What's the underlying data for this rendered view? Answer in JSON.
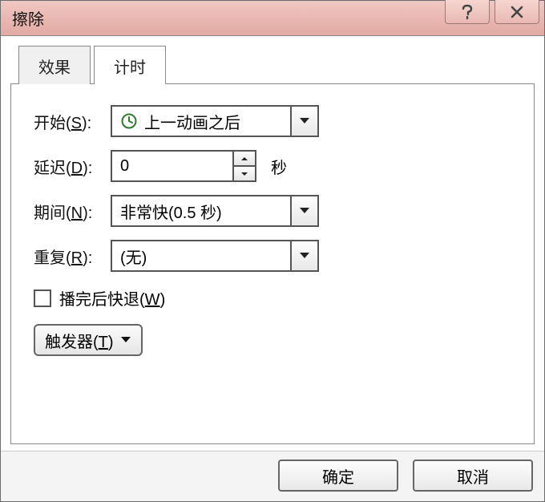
{
  "title": "擦除",
  "tabs": {
    "effect": "效果",
    "timing": "计时"
  },
  "labels": {
    "start_prefix": "开始(",
    "start_key": "S",
    "start_suffix": "):",
    "delay_prefix": "延迟(",
    "delay_key": "D",
    "delay_suffix": "):",
    "duration_prefix": "期间(",
    "duration_key": "N",
    "duration_suffix": "):",
    "repeat_prefix": "重复(",
    "repeat_key": "R",
    "repeat_suffix": "):",
    "delay_unit": "秒",
    "rewind_prefix": "播完后快退(",
    "rewind_key": "W",
    "rewind_suffix": ")",
    "trigger_prefix": "触发器(",
    "trigger_key": "T",
    "trigger_suffix": ")"
  },
  "values": {
    "start": "上一动画之后",
    "delay": "0",
    "duration": "非常快(0.5 秒)",
    "repeat": "(无)"
  },
  "rewind_checked": false,
  "buttons": {
    "ok": "确定",
    "cancel": "取消"
  }
}
